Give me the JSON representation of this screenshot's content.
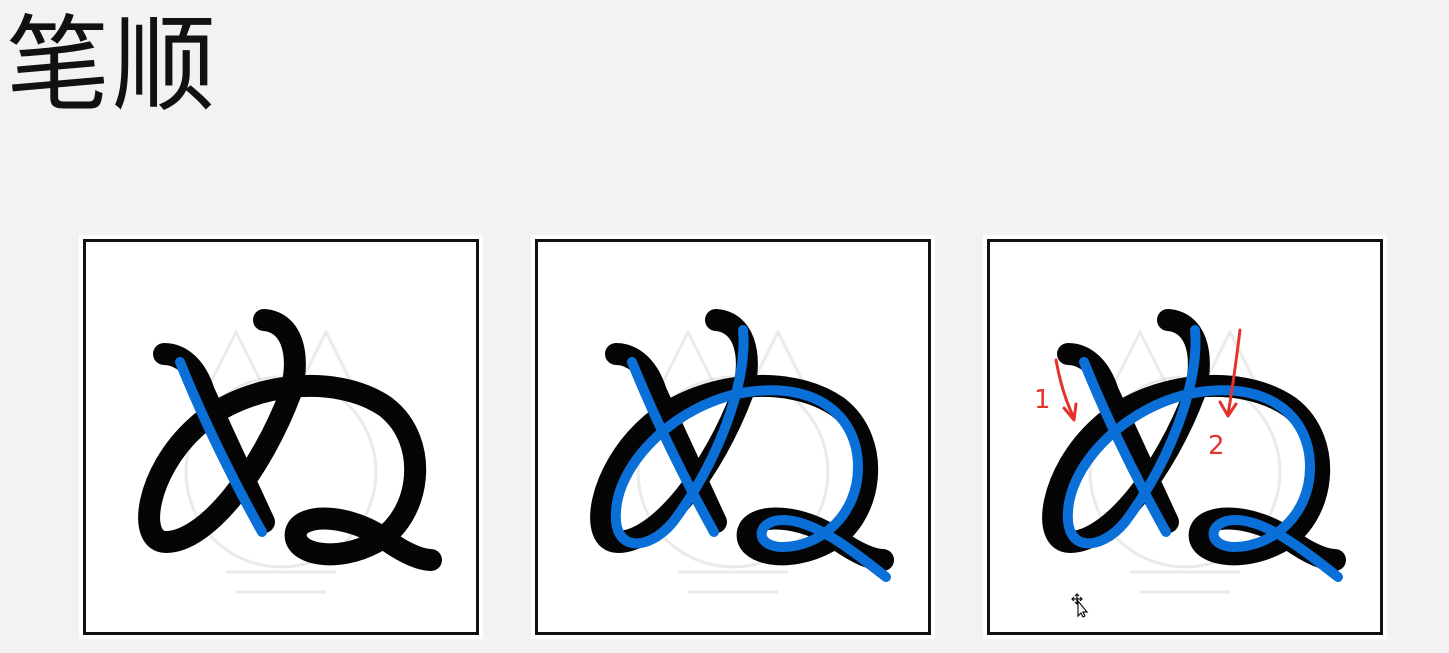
{
  "page": {
    "title": "笔顺",
    "background": "#f2f2f2"
  },
  "colors": {
    "stroke_guide": "#0a6fd6",
    "character": "#050505",
    "annotation": "#e3332c"
  },
  "panels": [
    {
      "id": "panel-1",
      "traced_strokes": 1
    },
    {
      "id": "panel-2",
      "traced_strokes": 2
    },
    {
      "id": "panel-3",
      "traced_strokes": 2,
      "annotations": [
        {
          "label": "1",
          "icon": "down-arrow-icon"
        },
        {
          "label": "2",
          "icon": "down-arrow-icon"
        }
      ]
    }
  ],
  "icons": {
    "cursor": "move-cursor-icon"
  }
}
